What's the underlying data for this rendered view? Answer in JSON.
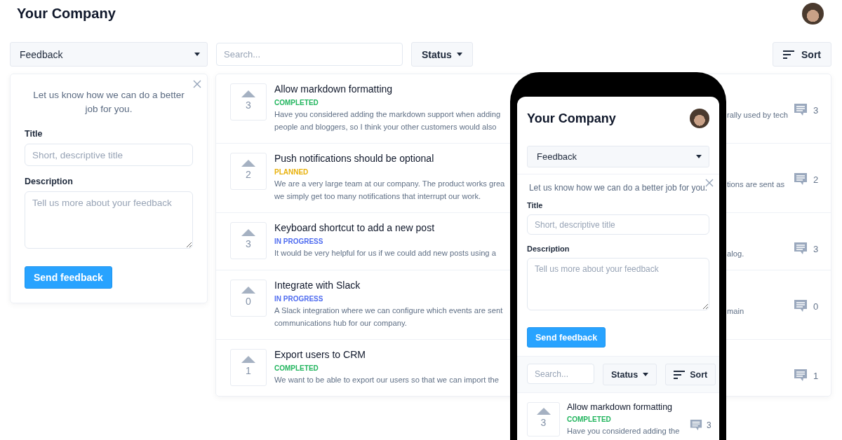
{
  "header": {
    "company": "Your Company"
  },
  "filters": {
    "board": "Feedback",
    "search_placeholder": "Search...",
    "status_label": "Status",
    "sort_label": "Sort"
  },
  "feedback_form": {
    "intro": "Let us know how we can do a better job for you.",
    "title_label": "Title",
    "title_placeholder": "Short, descriptive title",
    "description_label": "Description",
    "description_placeholder": "Tell us more about your feedback",
    "submit": "Send feedback"
  },
  "posts": [
    {
      "votes": "3",
      "title": "Allow markdown formatting",
      "status": "COMPLETED",
      "color": "#22b55e",
      "description_left": [
        "Have you considered adding the markdown support when adding",
        "people and bloggers, so I think your other customers would also"
      ],
      "description_right": [
        "rally used by tech"
      ],
      "comments": "3"
    },
    {
      "votes": "2",
      "title": "Push notifications should be optional",
      "status": "PLANNED",
      "color": "#e8b10c",
      "description_left": [
        "We are a very large team at our company. The product works grea",
        "we simply get too many notifications that interrupt our work."
      ],
      "description_right": [
        "tions are sent as"
      ],
      "comments": "2"
    },
    {
      "votes": "3",
      "title": "Keyboard shortcut to add a new post",
      "status": "IN PROGRESS",
      "color": "#4f6cf0",
      "description_left": [
        "It would be very helpful for us if we could add new posts using a"
      ],
      "description_right": [
        "alog."
      ],
      "comments": "3"
    },
    {
      "votes": "0",
      "title": "Integrate with Slack",
      "status": "IN PROGRESS",
      "color": "#4f6cf0",
      "description_left": [
        "A Slack integration where we can configure which events are sent",
        "communications hub for our company."
      ],
      "description_right": [
        "main"
      ],
      "comments": "0"
    },
    {
      "votes": "1",
      "title": "Export users to CRM",
      "status": "COMPLETED",
      "color": "#22b55e",
      "description_left": [
        "We want to be able to export our users so that we can import the"
      ],
      "comments": "1"
    }
  ],
  "phone": {
    "company": "Your Company",
    "board": "Feedback",
    "intro": "Let us know how we can do a better job for you.",
    "title_label": "Title",
    "title_placeholder": "Short, descriptive title",
    "description_label": "Description",
    "description_placeholder": "Tell us more about your feedback",
    "submit": "Send feedback",
    "search_placeholder": "Search...",
    "status_label": "Status",
    "sort_label": "Sort",
    "post": {
      "votes": "3",
      "title": "Allow markdown formatting",
      "status": "COMPLETED",
      "color": "#22b55e",
      "description": "Have you considered adding the",
      "comments": "3"
    }
  }
}
